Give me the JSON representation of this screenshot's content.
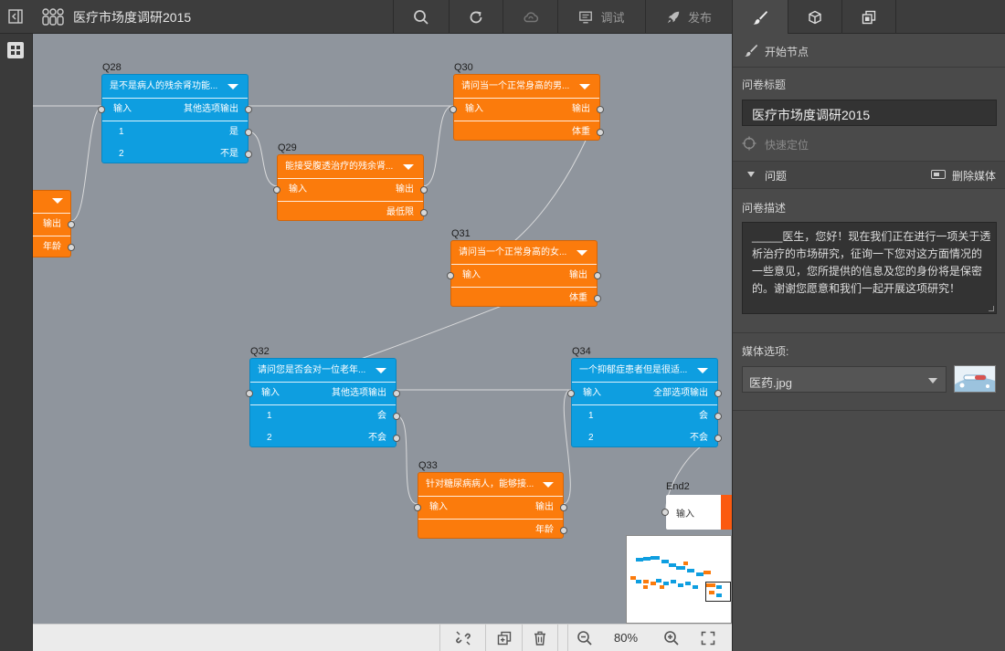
{
  "app": {
    "title": "医疗市场度调研2015"
  },
  "toolbar": {
    "debug_label": "调试",
    "publish_label": "发布"
  },
  "panel": {
    "start_node_label": "开始节点",
    "survey_title_label": "问卷标题",
    "survey_title_value": "医疗市场度调研2015",
    "quick_locate_label": "快速定位",
    "question_label": "问题",
    "delete_media_label": "删除媒体",
    "description_label": "问卷描述",
    "description_value": "_____医生，您好！现在我们正在进行一项关于透析治疗的市场研究，征询一下您对这方面情况的一些意见，您所提供的信息及您的身份将是保密的。谢谢您愿意和我们一起开展这项研究！",
    "media_options_label": "媒体选项:",
    "media_selected": "医药.jpg"
  },
  "canvas": {
    "partial_node": {
      "output_label": "输出",
      "age_label": "年龄"
    },
    "nodes": [
      {
        "id": "Q28",
        "color": "blue",
        "title": "是不是病人的残余肾功能...",
        "input": "输入",
        "output": "其他选项输出",
        "options": [
          {
            "num": "1",
            "label": "是"
          },
          {
            "num": "2",
            "label": "不是"
          }
        ]
      },
      {
        "id": "Q29",
        "color": "orange",
        "title": "能接受腹透治疗的残余肾...",
        "input": "输入",
        "output": "输出",
        "footer": "最低限"
      },
      {
        "id": "Q30",
        "color": "orange",
        "title": "请问当一个正常身高的男...",
        "input": "输入",
        "output": "输出",
        "footer": "体重"
      },
      {
        "id": "Q31",
        "color": "orange",
        "title": "请问当一个正常身高的女...",
        "input": "输入",
        "output": "输出",
        "footer": "体重"
      },
      {
        "id": "Q32",
        "color": "blue",
        "title": "请问您是否会对一位老年...",
        "input": "输入",
        "output": "其他选项输出",
        "options": [
          {
            "num": "1",
            "label": "会"
          },
          {
            "num": "2",
            "label": "不会"
          }
        ]
      },
      {
        "id": "Q33",
        "color": "orange",
        "title": "针对糖尿病病人，能够接...",
        "input": "输入",
        "output": "输出",
        "footer": "年龄"
      },
      {
        "id": "Q34",
        "color": "blue",
        "title": "一个抑郁症患者但是很适...",
        "input": "输入",
        "output": "全部选项输出",
        "options": [
          {
            "num": "1",
            "label": "会"
          },
          {
            "num": "2",
            "label": "不会"
          }
        ]
      }
    ],
    "end_node": {
      "id": "End2",
      "input": "输入"
    }
  },
  "bottombar": {
    "zoom": "80%"
  },
  "colors": {
    "blue_node": "#0e9ee0",
    "orange_node": "#fb7b0c",
    "canvas_bg": "#8f959d",
    "panel_bg": "#4a4a4a"
  }
}
